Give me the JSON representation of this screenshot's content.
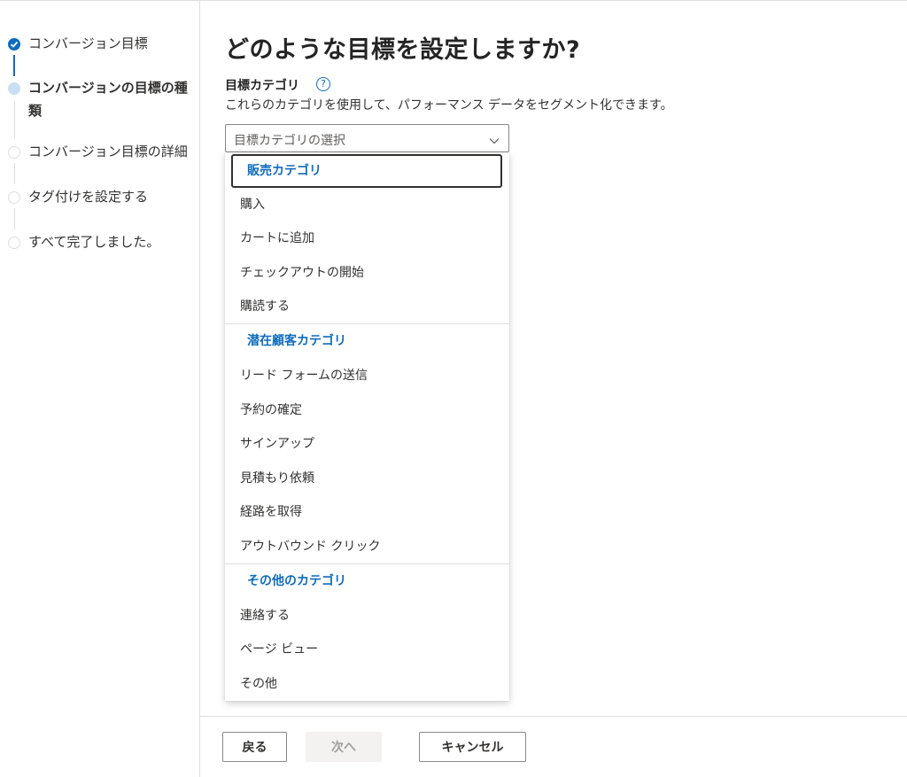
{
  "steps": [
    {
      "label": "コンバージョン目標",
      "state": "done"
    },
    {
      "label": "コンバージョンの目標の種類",
      "state": "current"
    },
    {
      "label": "コンバージョン目標の詳細",
      "state": "todo"
    },
    {
      "label": "タグ付けを設定する",
      "state": "todo"
    },
    {
      "label": "すべて完了しました。",
      "state": "todo"
    }
  ],
  "main": {
    "title": "どのような目標を設定しますか?",
    "field_label": "目標カテゴリ",
    "help_icon": "?",
    "description": "これらのカテゴリを使用して、パフォーマンス データをセグメント化できます。",
    "select_placeholder": "目標カテゴリの選択"
  },
  "dropdown": {
    "groups": [
      {
        "header": "販売カテゴリ",
        "items": [
          "購入",
          "カートに追加",
          "チェックアウトの開始",
          "購読する"
        ]
      },
      {
        "header": "潜在顧客カテゴリ",
        "items": [
          "リード フォームの送信",
          "予約の確定",
          "サインアップ",
          "見積もり依頼",
          "経路を取得",
          "アウトバウンド クリック"
        ]
      },
      {
        "header": "その他のカテゴリ",
        "items": [
          "連絡する",
          "ページ ビュー",
          "その他"
        ]
      }
    ]
  },
  "footer": {
    "back": "戻る",
    "next": "次へ",
    "cancel": "キャンセル"
  },
  "colors": {
    "accent": "#0f6cbd",
    "current_step_dot": "#c7e0f4"
  }
}
